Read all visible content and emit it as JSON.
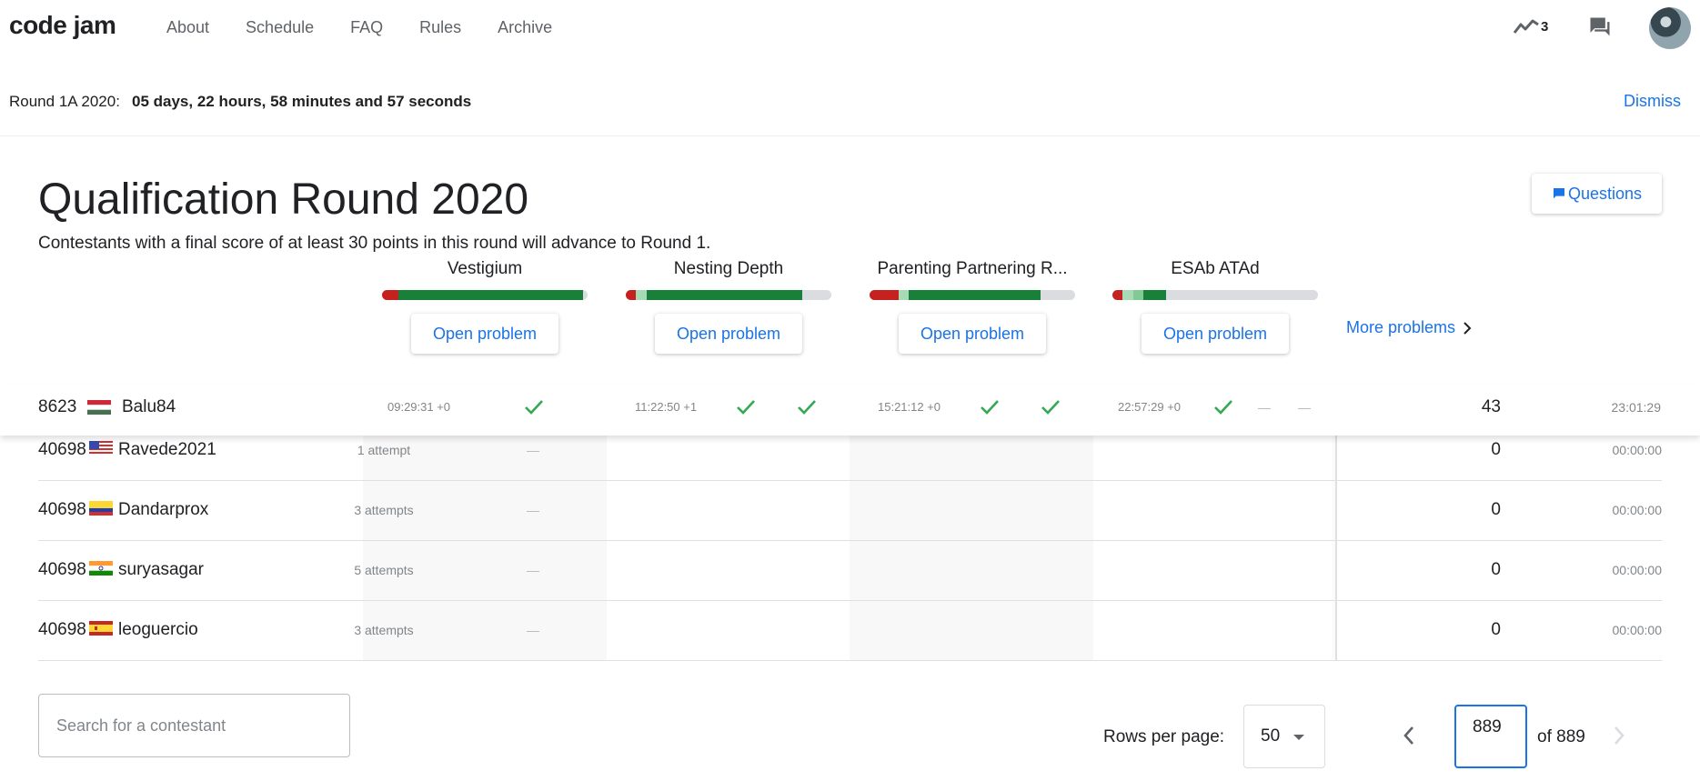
{
  "header": {
    "logo": "code jam",
    "nav": [
      "About",
      "Schedule",
      "FAQ",
      "Rules",
      "Archive"
    ],
    "notification_count": "3"
  },
  "banner": {
    "label": "Round 1A 2020:",
    "countdown": "05 days, 22 hours, 58 minutes and 57 seconds",
    "dismiss": "Dismiss"
  },
  "round": {
    "title": "Qualification Round 2020",
    "subtitle": "Contestants with a final score of at least 30 points in this round will advance to Round 1.",
    "questions_label": "Questions"
  },
  "problems": [
    {
      "name": "Vestigium",
      "open_label": "Open problem",
      "bar": [
        {
          "color": "#c5221f",
          "pct": 8
        },
        {
          "color": "#188038",
          "pct": 90
        }
      ]
    },
    {
      "name": "Nesting Depth",
      "open_label": "Open problem",
      "bar": [
        {
          "color": "#c5221f",
          "pct": 5
        },
        {
          "color": "#a8dab5",
          "pct": 5
        },
        {
          "color": "#188038",
          "pct": 76
        }
      ]
    },
    {
      "name": "Parenting Partnering R...",
      "open_label": "Open problem",
      "bar": [
        {
          "color": "#c5221f",
          "pct": 14
        },
        {
          "color": "#a8dab5",
          "pct": 5
        },
        {
          "color": "#188038",
          "pct": 64
        }
      ]
    },
    {
      "name": "ESAb ATAd",
      "open_label": "Open problem",
      "bar": [
        {
          "color": "#c5221f",
          "pct": 5
        },
        {
          "color": "#a8dab5",
          "pct": 5
        },
        {
          "color": "#81c995",
          "pct": 5
        },
        {
          "color": "#188038",
          "pct": 11
        }
      ]
    }
  ],
  "more_problems": "More problems",
  "me": {
    "rank": "8623",
    "user": "Balu84",
    "times": [
      "09:29:31 +0",
      "11:22:50 +1",
      "15:21:12 +0",
      "22:57:29 +0"
    ],
    "score": "43",
    "total_time": "23:01:29"
  },
  "rows": [
    {
      "rank": "40698",
      "user": "Ravede2021",
      "flag": "us",
      "attempts": "1 attempt",
      "score": "0",
      "time": "00:00:00"
    },
    {
      "rank": "40698",
      "user": "Dandarprox",
      "flag": "co",
      "attempts": "3 attempts",
      "score": "0",
      "time": "00:00:00"
    },
    {
      "rank": "40698",
      "user": "suryasagar",
      "flag": "in",
      "attempts": "5 attempts",
      "score": "0",
      "time": "00:00:00"
    },
    {
      "rank": "40698",
      "user": "leoguercio",
      "flag": "es",
      "attempts": "3 attempts",
      "score": "0",
      "time": "00:00:00"
    }
  ],
  "footer": {
    "search_placeholder": "Search for a contestant",
    "rows_per_page_label": "Rows per page:",
    "rows_per_page": "50",
    "page": "889",
    "of_label": "of 889"
  }
}
